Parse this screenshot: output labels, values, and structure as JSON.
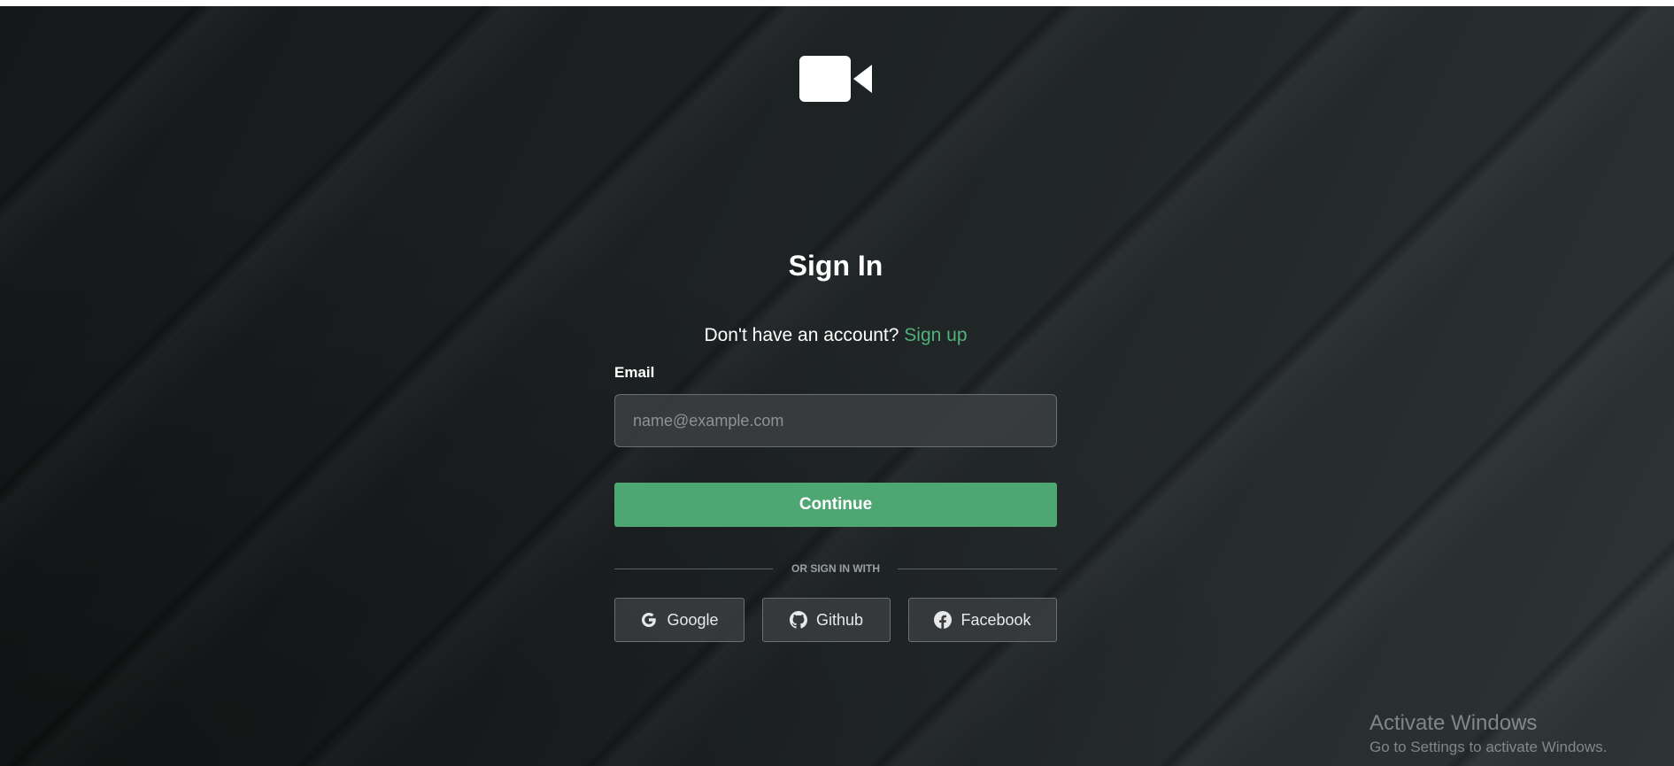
{
  "logo": {
    "icon": "video-camera-icon"
  },
  "auth": {
    "title": "Sign In",
    "signup_prompt": "Don't have an account?",
    "signup_link": "Sign up",
    "email_label": "Email",
    "email_placeholder": "name@example.com",
    "email_value": "",
    "continue_label": "Continue",
    "divider_text": "OR SIGN IN WITH"
  },
  "social": [
    {
      "label": "Google",
      "icon": "google-icon"
    },
    {
      "label": "Github",
      "icon": "github-icon"
    },
    {
      "label": "Facebook",
      "icon": "facebook-icon"
    }
  ],
  "watermark": {
    "title": "Activate Windows",
    "subtitle": "Go to Settings to activate Windows."
  },
  "colors": {
    "accent": "#4ea772",
    "link": "#4fb37a",
    "background": "#1c2021"
  }
}
